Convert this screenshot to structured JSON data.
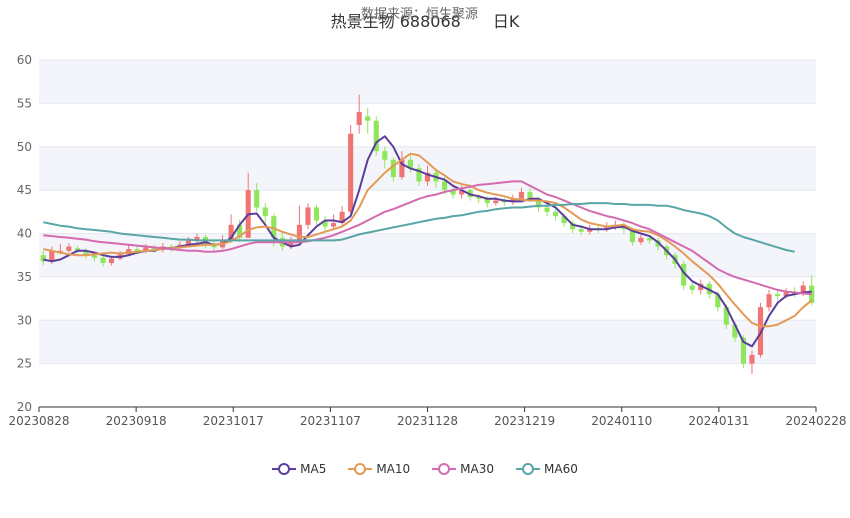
{
  "header": {
    "title": "热景生物 688068　　日K",
    "source": "数据来源：恒生聚源"
  },
  "colors": {
    "up": "#f07474",
    "down": "#8ee65a",
    "ma5": "#5b3d9b",
    "ma10": "#e39a56",
    "ma30": "#d46bb0",
    "ma60": "#5aa5a5"
  },
  "chart_data": {
    "type": "candlestick",
    "ylim": [
      20,
      60
    ],
    "yticks": [
      20,
      25,
      30,
      35,
      40,
      45,
      50,
      55,
      60
    ],
    "grid": true,
    "legend_position": "bottom",
    "x_tick_labels": [
      "20230828",
      "20230918",
      "20231017",
      "20231107",
      "20231128",
      "20231219",
      "20240110",
      "20240131",
      "20240228"
    ],
    "series": [
      {
        "name": "MA5",
        "values": [
          37.0,
          36.8,
          37.0,
          37.5,
          38.0,
          38.0,
          37.8,
          37.5,
          37.3,
          37.3,
          37.5,
          37.8,
          38.0,
          38.0,
          38.3,
          38.3,
          38.5,
          38.7,
          38.8,
          39.0,
          38.7,
          38.8,
          39.5,
          41.0,
          42.2,
          42.3,
          41.0,
          39.5,
          39.0,
          38.5,
          38.7,
          39.8,
          40.8,
          41.5,
          41.5,
          41.3,
          42.0,
          45.0,
          48.5,
          50.5,
          51.2,
          50.0,
          48.0,
          47.5,
          47.2,
          46.8,
          46.5,
          46.2,
          45.5,
          45.0,
          44.5,
          44.3,
          44.0,
          44.0,
          43.8,
          43.7,
          43.7,
          44.0,
          44.0,
          43.5,
          43.0,
          42.0,
          41.0,
          40.8,
          40.5,
          40.5,
          40.5,
          40.7,
          40.8,
          40.3,
          40.0,
          39.7,
          39.0,
          38.0,
          37.0,
          35.5,
          34.5,
          34.0,
          33.5,
          33.0,
          31.5,
          29.5,
          27.5,
          27.0,
          28.5,
          30.5,
          32.0,
          32.8,
          33.0,
          33.2,
          33.3
        ]
      },
      {
        "name": "MA10",
        "values": [
          38.2,
          38.0,
          37.8,
          37.6,
          37.5,
          37.5,
          37.6,
          37.7,
          37.8,
          37.7,
          37.8,
          37.9,
          38.0,
          38.1,
          38.2,
          38.3,
          38.4,
          38.5,
          38.6,
          38.7,
          38.7,
          38.8,
          39.1,
          39.7,
          40.4,
          40.7,
          40.8,
          40.6,
          40.2,
          39.9,
          39.6,
          39.6,
          39.9,
          40.2,
          40.5,
          40.8,
          41.5,
          43.0,
          45.0,
          46.0,
          47.0,
          47.8,
          48.5,
          49.2,
          49.0,
          48.2,
          47.3,
          46.7,
          46.0,
          45.7,
          45.5,
          45.0,
          44.7,
          44.5,
          44.3,
          44.0,
          43.9,
          43.8,
          43.8,
          43.7,
          43.5,
          43.0,
          42.3,
          41.6,
          41.2,
          41.0,
          40.8,
          40.9,
          41.0,
          40.5,
          40.3,
          40.2,
          39.8,
          39.2,
          38.5,
          37.7,
          36.8,
          36.0,
          35.2,
          34.2,
          33.0,
          31.8,
          30.7,
          29.7,
          29.3,
          29.3,
          29.5,
          30.0,
          30.5,
          31.5,
          32.3
        ]
      },
      {
        "name": "MA30",
        "values": [
          39.8,
          39.7,
          39.6,
          39.5,
          39.4,
          39.3,
          39.1,
          39.0,
          38.9,
          38.8,
          38.7,
          38.6,
          38.5,
          38.4,
          38.3,
          38.2,
          38.1,
          38.0,
          38.0,
          37.9,
          37.9,
          38.0,
          38.2,
          38.5,
          38.8,
          39.0,
          39.0,
          39.0,
          39.0,
          39.0,
          39.0,
          39.1,
          39.3,
          39.5,
          39.8,
          40.2,
          40.6,
          41.0,
          41.5,
          42.0,
          42.5,
          42.8,
          43.2,
          43.6,
          44.0,
          44.3,
          44.5,
          44.8,
          45.0,
          45.2,
          45.4,
          45.6,
          45.7,
          45.8,
          45.9,
          46.0,
          46.0,
          45.5,
          45.0,
          44.5,
          44.2,
          43.8,
          43.4,
          43.0,
          42.6,
          42.3,
          42.0,
          41.8,
          41.5,
          41.2,
          40.8,
          40.5,
          40.0,
          39.5,
          39.0,
          38.5,
          38.0,
          37.3,
          36.6,
          35.9,
          35.4,
          35.0,
          34.7,
          34.4,
          34.1,
          33.8,
          33.5,
          33.3,
          33.2,
          33.1,
          33.0
        ]
      },
      {
        "name": "MA60",
        "values": [
          41.3,
          41.1,
          40.9,
          40.8,
          40.6,
          40.5,
          40.4,
          40.3,
          40.2,
          40.0,
          39.9,
          39.8,
          39.7,
          39.6,
          39.5,
          39.4,
          39.3,
          39.3,
          39.2,
          39.2,
          39.2,
          39.2,
          39.2,
          39.2,
          39.2,
          39.2,
          39.2,
          39.2,
          39.2,
          39.2,
          39.2,
          39.2,
          39.2,
          39.2,
          39.2,
          39.3,
          39.6,
          39.9,
          40.1,
          40.3,
          40.5,
          40.7,
          40.9,
          41.1,
          41.3,
          41.5,
          41.7,
          41.8,
          42.0,
          42.1,
          42.3,
          42.5,
          42.6,
          42.8,
          42.9,
          43.0,
          43.0,
          43.1,
          43.2,
          43.2,
          43.3,
          43.3,
          43.4,
          43.4,
          43.5,
          43.5,
          43.5,
          43.4,
          43.4,
          43.3,
          43.3,
          43.3,
          43.2,
          43.2,
          43.0,
          42.7,
          42.5,
          42.3,
          42.0,
          41.5,
          40.7,
          40.0,
          39.6,
          39.3,
          39.0,
          38.7,
          38.4,
          38.1,
          37.9
        ]
      }
    ],
    "candles": [
      [
        37.5,
        36.8,
        38.0,
        36.3
      ],
      [
        36.8,
        38.0,
        38.5,
        36.5
      ],
      [
        38.0,
        38.0,
        38.8,
        37.6
      ],
      [
        38.0,
        38.5,
        38.9,
        37.8
      ],
      [
        38.3,
        38.1,
        38.6,
        37.7
      ],
      [
        37.9,
        37.5,
        38.3,
        37.1
      ],
      [
        37.5,
        37.2,
        37.9,
        36.8
      ],
      [
        37.2,
        36.6,
        37.5,
        36.2
      ],
      [
        36.6,
        37.1,
        37.4,
        36.3
      ],
      [
        37.1,
        37.6,
        38.0,
        36.9
      ],
      [
        37.6,
        38.2,
        38.7,
        37.4
      ],
      [
        38.2,
        38.0,
        38.5,
        37.6
      ],
      [
        38.0,
        38.4,
        38.8,
        37.7
      ],
      [
        38.4,
        38.1,
        38.7,
        37.8
      ],
      [
        38.1,
        38.5,
        38.9,
        37.8
      ],
      [
        38.5,
        38.3,
        38.8,
        37.9
      ],
      [
        38.3,
        38.7,
        39.1,
        38.0
      ],
      [
        38.7,
        39.2,
        39.6,
        38.5
      ],
      [
        39.2,
        39.6,
        40.0,
        38.9
      ],
      [
        39.6,
        38.8,
        39.9,
        38.3
      ],
      [
        38.8,
        38.4,
        39.2,
        38.0
      ],
      [
        38.4,
        39.3,
        39.8,
        38.2
      ],
      [
        39.3,
        41.0,
        42.2,
        39.0
      ],
      [
        41.0,
        39.5,
        41.6,
        39.0
      ],
      [
        39.5,
        45.0,
        47.0,
        39.5
      ],
      [
        45.0,
        43.0,
        45.8,
        42.5
      ],
      [
        43.0,
        42.0,
        43.5,
        41.2
      ],
      [
        42.0,
        39.5,
        42.3,
        38.5
      ],
      [
        39.5,
        38.5,
        40.2,
        38.0
      ],
      [
        38.5,
        39.0,
        39.6,
        38.2
      ],
      [
        39.0,
        41.0,
        43.2,
        38.8
      ],
      [
        41.0,
        43.0,
        43.5,
        40.5
      ],
      [
        43.0,
        41.5,
        43.3,
        41.0
      ],
      [
        41.5,
        40.8,
        42.0,
        40.3
      ],
      [
        40.8,
        41.2,
        42.2,
        40.5
      ],
      [
        41.2,
        42.5,
        43.2,
        40.8
      ],
      [
        42.5,
        51.5,
        52.5,
        42.2
      ],
      [
        52.5,
        54.0,
        56.0,
        51.5
      ],
      [
        53.5,
        53.0,
        54.5,
        51.5
      ],
      [
        53.0,
        49.5,
        53.5,
        49.0
      ],
      [
        49.5,
        48.5,
        50.0,
        47.5
      ],
      [
        48.5,
        46.5,
        48.8,
        46.0
      ],
      [
        46.5,
        48.5,
        49.5,
        46.2
      ],
      [
        48.5,
        47.5,
        49.0,
        47.0
      ],
      [
        47.5,
        46.0,
        48.0,
        45.5
      ],
      [
        46.0,
        47.0,
        47.8,
        45.5
      ],
      [
        47.0,
        46.0,
        47.5,
        45.3
      ],
      [
        46.0,
        45.0,
        46.5,
        44.5
      ],
      [
        45.0,
        44.5,
        45.5,
        44.0
      ],
      [
        44.5,
        45.0,
        45.5,
        44.0
      ],
      [
        45.0,
        44.2,
        45.3,
        43.8
      ],
      [
        44.2,
        44.0,
        44.5,
        43.5
      ],
      [
        44.0,
        43.5,
        44.3,
        43.0
      ],
      [
        43.5,
        43.8,
        44.2,
        43.2
      ],
      [
        43.8,
        43.6,
        44.1,
        43.2
      ],
      [
        43.6,
        44.0,
        44.5,
        43.3
      ],
      [
        44.0,
        44.8,
        45.3,
        43.8
      ],
      [
        44.8,
        44.0,
        45.2,
        43.6
      ],
      [
        44.0,
        43.0,
        44.2,
        42.5
      ],
      [
        43.0,
        42.5,
        43.3,
        42.0
      ],
      [
        42.5,
        42.0,
        42.8,
        41.5
      ],
      [
        42.0,
        41.2,
        42.3,
        40.8
      ],
      [
        41.2,
        40.5,
        41.5,
        40.0
      ],
      [
        40.5,
        40.2,
        40.9,
        39.8
      ],
      [
        40.2,
        40.6,
        41.0,
        39.9
      ],
      [
        40.6,
        40.5,
        41.0,
        40.0
      ],
      [
        40.5,
        40.8,
        41.3,
        40.2
      ],
      [
        40.8,
        41.0,
        41.5,
        40.4
      ],
      [
        41.0,
        40.5,
        41.3,
        40.0
      ],
      [
        40.5,
        39.0,
        40.7,
        38.6
      ],
      [
        39.0,
        39.5,
        40.0,
        38.7
      ],
      [
        39.5,
        39.2,
        39.8,
        38.8
      ],
      [
        39.2,
        38.5,
        39.5,
        38.0
      ],
      [
        38.5,
        37.5,
        38.7,
        37.0
      ],
      [
        37.5,
        36.5,
        37.8,
        36.0
      ],
      [
        36.5,
        34.0,
        36.8,
        33.5
      ],
      [
        34.0,
        33.5,
        34.5,
        33.0
      ],
      [
        33.5,
        34.2,
        34.7,
        33.0
      ],
      [
        34.2,
        33.0,
        34.5,
        32.5
      ],
      [
        33.0,
        31.5,
        33.3,
        31.0
      ],
      [
        31.5,
        29.5,
        31.8,
        29.0
      ],
      [
        29.5,
        28.0,
        29.8,
        27.5
      ],
      [
        28.0,
        25.0,
        28.3,
        24.5
      ],
      [
        25.0,
        26.0,
        26.5,
        23.8
      ],
      [
        26.0,
        31.5,
        32.0,
        25.7
      ],
      [
        31.5,
        33.0,
        33.5,
        31.0
      ],
      [
        33.0,
        32.8,
        33.6,
        32.3
      ],
      [
        32.8,
        33.2,
        33.7,
        32.5
      ],
      [
        33.2,
        33.0,
        33.8,
        32.7
      ],
      [
        33.0,
        34.0,
        34.5,
        32.8
      ],
      [
        34.0,
        32.0,
        35.2,
        31.7
      ]
    ]
  }
}
